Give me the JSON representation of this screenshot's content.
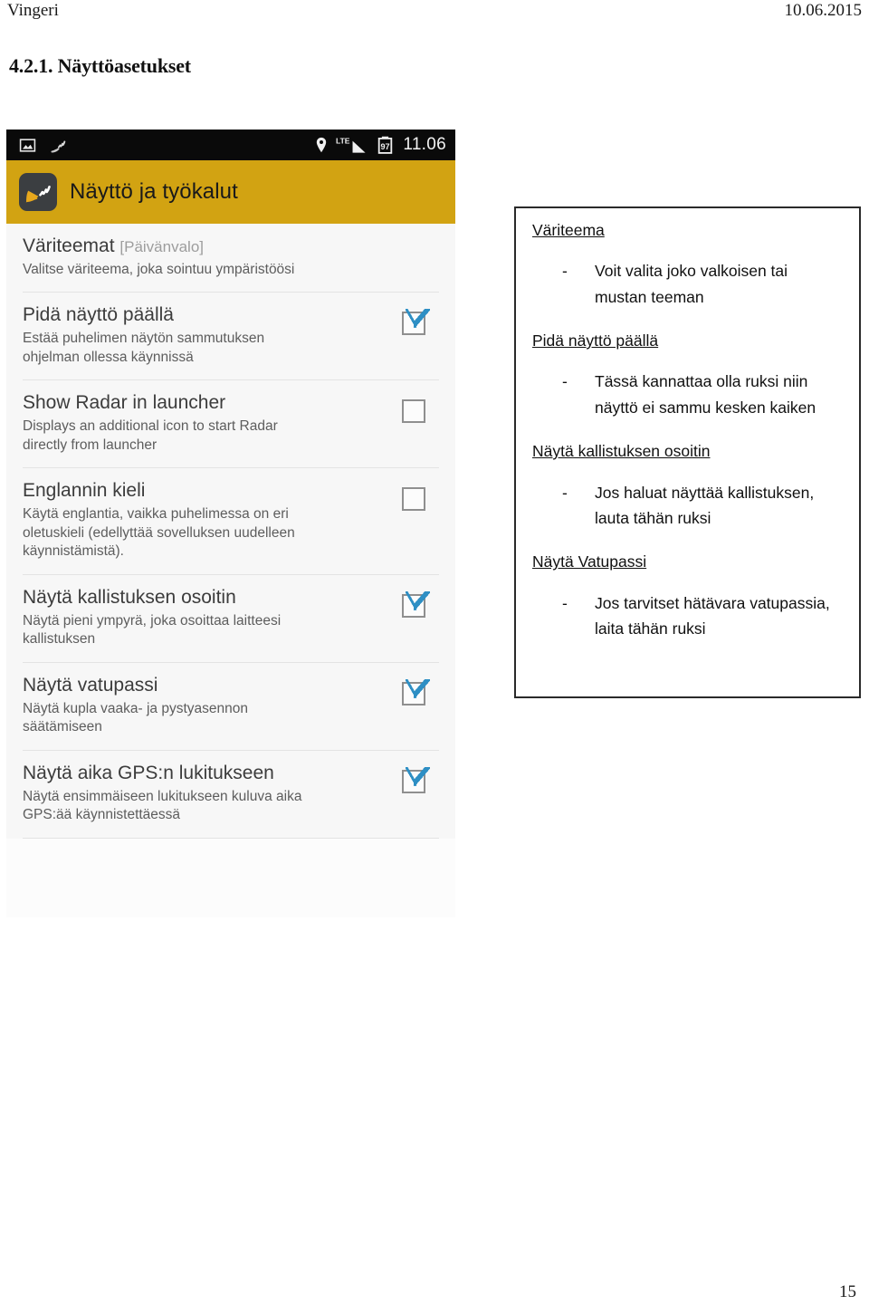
{
  "document": {
    "header_left": "Vingeri",
    "header_right": "10.06.2015",
    "section_title": "4.2.1. Näyttöasetukset",
    "page_number": "15"
  },
  "phone_screenshot": {
    "status_bar": {
      "icons_left": [
        "screenshot-image-icon",
        "satellite-gps-icon"
      ],
      "icons_right": [
        "location-pin-icon",
        "lte-signal-icon",
        "battery-icon"
      ],
      "lte_label": "LTE",
      "battery_level": "97",
      "time": "11.06"
    },
    "app_bar": {
      "title": "Näyttö ja työkalut",
      "icon": "radar-app-icon",
      "background_color": "#d2a312"
    },
    "settings": [
      {
        "title": "Väriteemat",
        "title_suffix": "[Päivänvalo]",
        "description": "Valitse väriteema, joka sointuu ympäristöösi",
        "has_checkbox": false,
        "checked": false
      },
      {
        "title": "Pidä näyttö päällä",
        "title_suffix": "",
        "description": "Estää puhelimen näytön sammutuksen ohjelman ollessa käynnissä",
        "has_checkbox": true,
        "checked": true
      },
      {
        "title": "Show Radar in launcher",
        "title_suffix": "",
        "description": "Displays an additional icon to start Radar directly from launcher",
        "has_checkbox": true,
        "checked": false
      },
      {
        "title": "Englannin kieli",
        "title_suffix": "",
        "description": "Käytä englantia, vaikka puhelimessa on eri oletuskieli (edellyttää sovelluksen uudelleen käynnistämistä).",
        "has_checkbox": true,
        "checked": false
      },
      {
        "title": "Näytä kallistuksen osoitin",
        "title_suffix": "",
        "description": "Näytä pieni ympyrä, joka osoittaa laitteesi kallistuksen",
        "has_checkbox": true,
        "checked": true
      },
      {
        "title": "Näytä vatupassi",
        "title_suffix": "",
        "description": "Näytä kupla vaaka- ja pystyasennon säätämiseen",
        "has_checkbox": true,
        "checked": true
      },
      {
        "title": "Näytä aika GPS:n lukitukseen",
        "title_suffix": "",
        "description": "Näytä ensimmäiseen lukitukseen kuluva aika GPS:ää käynnistettäessä",
        "has_checkbox": true,
        "checked": true
      }
    ]
  },
  "annotation_box": {
    "dash": "-",
    "groups": [
      {
        "heading": "Väriteema",
        "text": "Voit valita joko valkoisen tai mustan teeman"
      },
      {
        "heading": "Pidä näyttö päällä",
        "text": "Tässä kannattaa olla ruksi niin näyttö ei sammu kesken kaiken"
      },
      {
        "heading": "Näytä kallistuksen osoitin",
        "text": "Jos haluat näyttää kallistuksen, lauta tähän ruksi"
      },
      {
        "heading": "Näytä Vatupassi",
        "text": "Jos tarvitset hätävara vatupassia, laita tähän ruksi"
      }
    ]
  },
  "colors": {
    "app_bar": "#d2a312",
    "status_bar": "#0a0a0a",
    "checkbox_check": "#2e8fc4",
    "list_bg": "#f7f7f7"
  }
}
